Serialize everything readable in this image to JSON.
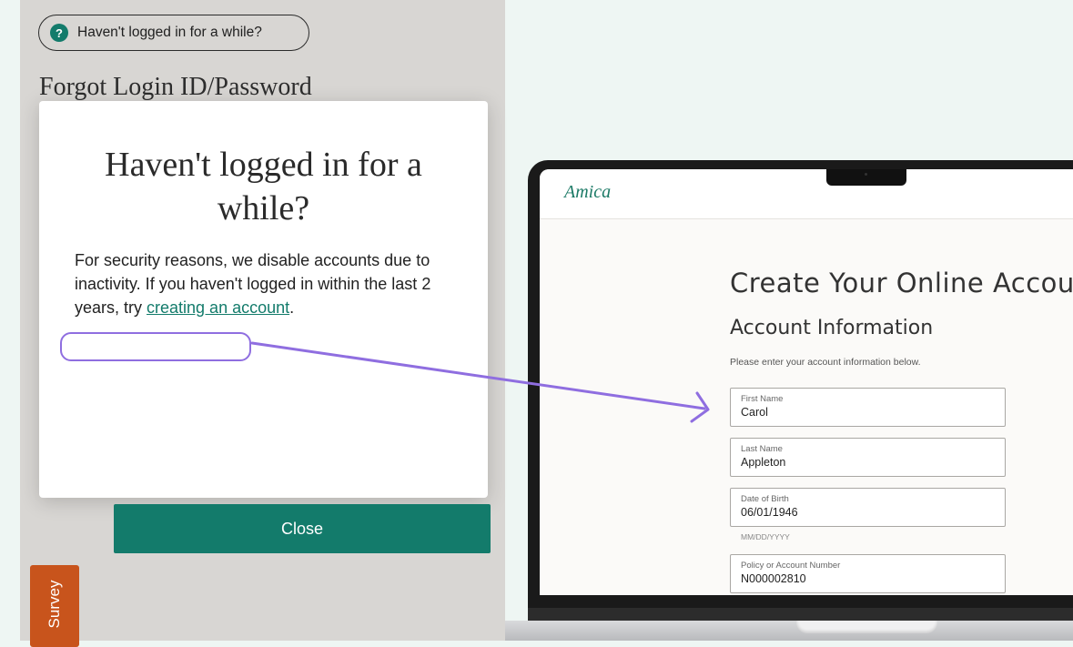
{
  "left_page": {
    "help_pill_text": "Haven't logged in for a while?",
    "help_icon_glyph": "?",
    "forgot_link": "Forgot Login ID/Password",
    "survey_tab": "Survey"
  },
  "modal": {
    "title_line1": "Haven't logged in for a",
    "title_line2": "while?",
    "body_text": "For security reasons, we disable accounts due to inactivity. If you haven't logged in within the last 2 years, try ",
    "link_text": "creating an account",
    "body_end": ".",
    "close_label": "Close"
  },
  "laptop_screen": {
    "logo": "Amica",
    "heading": "Create Your Online Accou",
    "subheading": "Account Information",
    "intro": "Please enter your account information below.",
    "fields": [
      {
        "label": "First Name",
        "value": "Carol"
      },
      {
        "label": "Last Name",
        "value": "Appleton"
      },
      {
        "label": "Date of Birth",
        "value": "06/01/1946"
      },
      {
        "label": "Policy or Account Number",
        "value": "N000002810"
      }
    ],
    "dob_hint": "MM/DD/YYYY"
  },
  "colors": {
    "brand_teal": "#137b6b",
    "annotation_purple": "#8f6ee0",
    "survey_orange": "#c8541c"
  },
  "icons": [
    "question-circle-icon",
    "annotation-arrow-icon"
  ]
}
